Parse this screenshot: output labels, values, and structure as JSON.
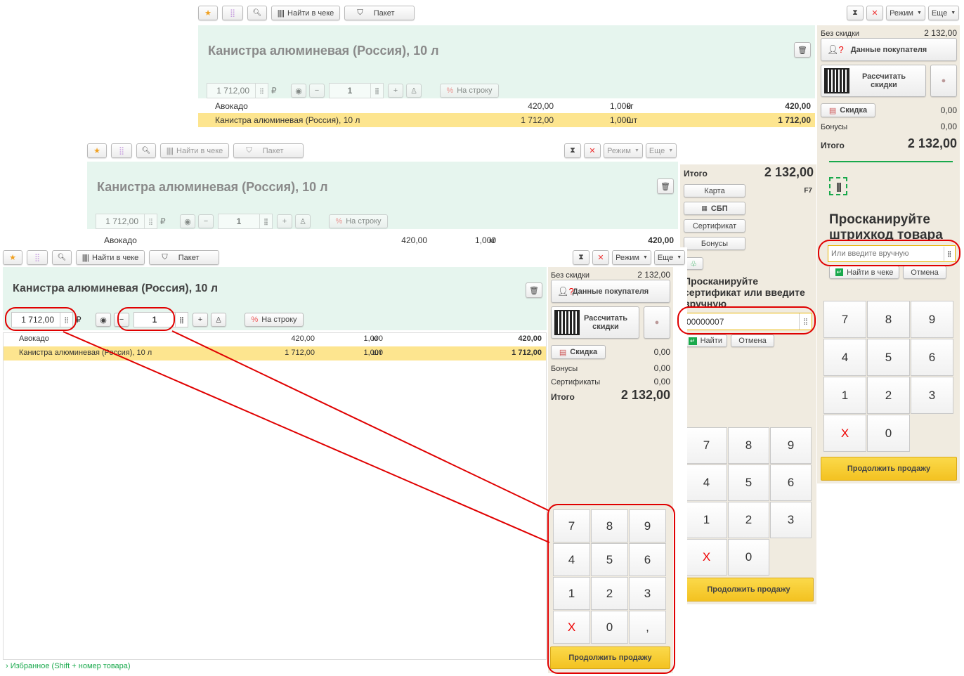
{
  "toolbar": {
    "find_in_receipt": "Найти в чеке",
    "package": "Пакет",
    "mode": "Режим",
    "more": "Еще"
  },
  "product": {
    "title": "Канистра алюминевая (Россия), 10 л",
    "price": "1 712,00",
    "currency": "₽",
    "quantity": "1",
    "per_line": "На строку"
  },
  "receipt_rows": [
    {
      "name": "Авокадо",
      "price": "420,00",
      "qty": "1,000",
      "unit": "кг",
      "sum": "420,00"
    },
    {
      "name": "Канистра алюминевая (Россия), 10 л",
      "price": "1 712,00",
      "qty": "1,000",
      "unit": "шт",
      "sum": "1 712,00"
    }
  ],
  "summary": {
    "no_discount_label": "Без скидки",
    "no_discount": "2 132,00",
    "buyer_data": "Данные покупателя",
    "calc_discounts": "Рассчитать скидки",
    "discount_label": "Скидка",
    "discount": "0,00",
    "bonuses_label": "Бонусы",
    "bonuses": "0,00",
    "certificates_label": "Сертификаты",
    "certificates": "0,00",
    "total_label": "Итого",
    "total": "2 132,00"
  },
  "payment": {
    "total_label": "Итого",
    "total": "2 132,00",
    "hotkey": "F7",
    "card": "Карта",
    "sbp": "СБП",
    "certificate": "Сертификат",
    "bonuses": "Бонусы",
    "scan_certificate": "Просканируйте сертификат или введите вручную",
    "certificate_input": "00000007",
    "find": "Найти",
    "cancel": "Отмена"
  },
  "scan": {
    "title": "Просканируйте штрихкод товара",
    "placeholder": "Или введите вручную",
    "find_in_receipt": "Найти в чеке",
    "cancel": "Отмена"
  },
  "keypad": [
    "7",
    "8",
    "9",
    "4",
    "5",
    "6",
    "1",
    "2",
    "3",
    "X",
    "0",
    ","
  ],
  "continue_sale": "Продолжить продажу",
  "favorites": "Избранное (Shift + номер товара)",
  "colors": {
    "accent_green": "#e6f5ee",
    "panel": "#f0ebe0",
    "highlight_row": "#fde58f",
    "annotation": "#e00000"
  }
}
